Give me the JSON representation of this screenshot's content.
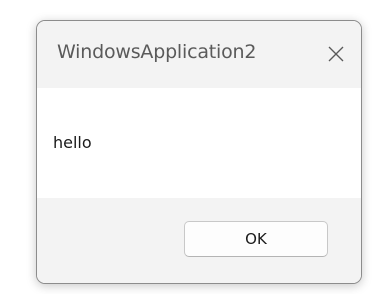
{
  "dialog": {
    "title": "WindowsApplication2",
    "message": "hello",
    "ok_label": "OK"
  },
  "icons": {
    "close": "close-icon"
  }
}
